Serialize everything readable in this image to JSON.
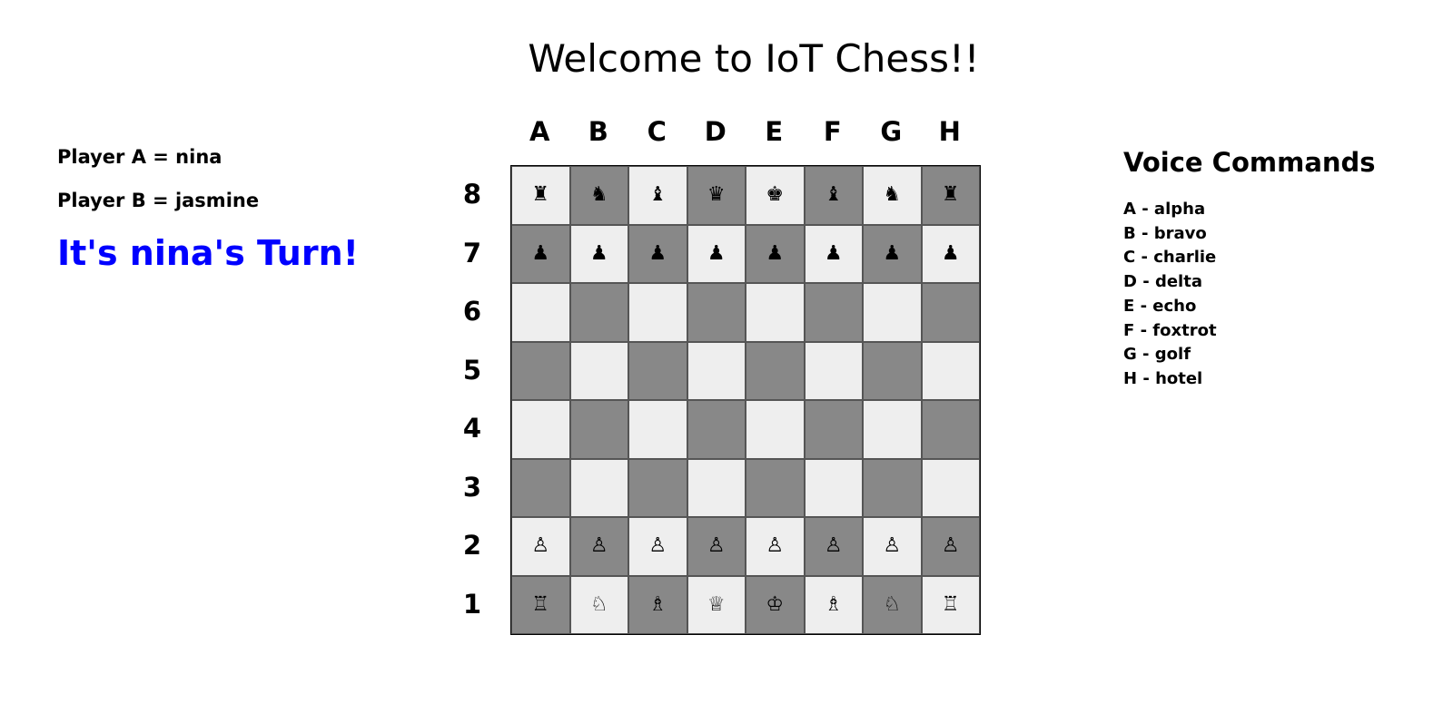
{
  "title": "Welcome to IoT Chess!!",
  "players": {
    "a": "Player A = nina",
    "b": "Player B = jasmine",
    "turn": "It's nina's Turn!",
    "turn_color": "#0000ff"
  },
  "board": {
    "columns": [
      "A",
      "B",
      "C",
      "D",
      "E",
      "F",
      "G",
      "H"
    ],
    "rows": [
      "8",
      "7",
      "6",
      "5",
      "4",
      "3",
      "2",
      "1"
    ],
    "light_color": "#eeeeee",
    "dark_color": "#888888",
    "pieces": [
      [
        "♜",
        "♞",
        "♝",
        "♛",
        "♚",
        "♝",
        "♞",
        "♜"
      ],
      [
        "♟",
        "♟",
        "♟",
        "♟",
        "♟",
        "♟",
        "♟",
        "♟"
      ],
      [
        "",
        "",
        "",
        "",
        "",
        "",
        "",
        ""
      ],
      [
        "",
        "",
        "",
        "",
        "",
        "",
        "",
        ""
      ],
      [
        "",
        "",
        "",
        "",
        "",
        "",
        "",
        ""
      ],
      [
        "",
        "",
        "",
        "",
        "",
        "",
        "",
        ""
      ],
      [
        "♙",
        "♙",
        "♙",
        "♙",
        "♙",
        "♙",
        "♙",
        "♙"
      ],
      [
        "♖",
        "♘",
        "♗",
        "♕",
        "♔",
        "♗",
        "♘",
        "♖"
      ]
    ]
  },
  "voice": {
    "heading": "Voice Commands",
    "commands": [
      "A - alpha",
      "B - bravo",
      "C - charlie",
      "D - delta",
      "E - echo",
      "F - foxtrot",
      "G - golf",
      "H - hotel"
    ]
  }
}
